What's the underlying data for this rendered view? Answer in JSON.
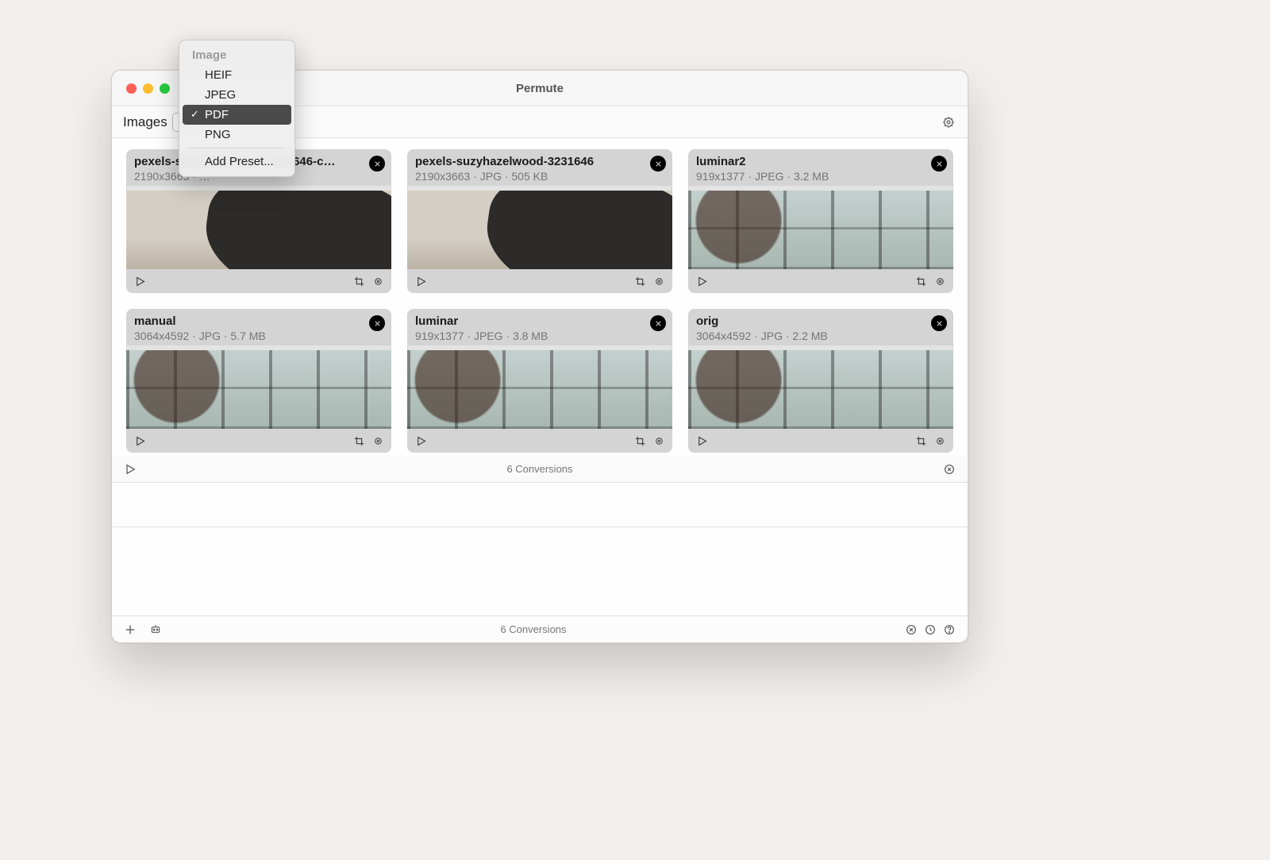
{
  "window_title": "Permute",
  "toolbar": {
    "category_label": "Images",
    "format_selected": "PDF"
  },
  "format_menu": {
    "header": "Image",
    "options": [
      "HEIF",
      "JPEG",
      "PDF",
      "PNG"
    ],
    "selected": "PDF",
    "add_preset_label": "Add Preset..."
  },
  "cards": [
    {
      "name": "pexels-suzyhazelwood-3231646-colori…",
      "meta": "2190x3663 · …",
      "thumb": "man"
    },
    {
      "name": "pexels-suzyhazelwood-3231646",
      "meta": "2190x3663 · JPG · 505 KB",
      "thumb": "man"
    },
    {
      "name": "luminar2",
      "meta": "919x1377 · JPEG · 3.2 MB",
      "thumb": "room"
    },
    {
      "name": "manual",
      "meta": "3064x4592 · JPG · 5.7 MB",
      "thumb": "room"
    },
    {
      "name": "luminar",
      "meta": "919x1377 · JPEG · 3.8 MB",
      "thumb": "room"
    },
    {
      "name": "orig",
      "meta": "3064x4592 · JPG · 2.2 MB",
      "thumb": "room"
    }
  ],
  "conversions_bar_text": "6 Conversions",
  "bottom_bar_text": "6 Conversions"
}
